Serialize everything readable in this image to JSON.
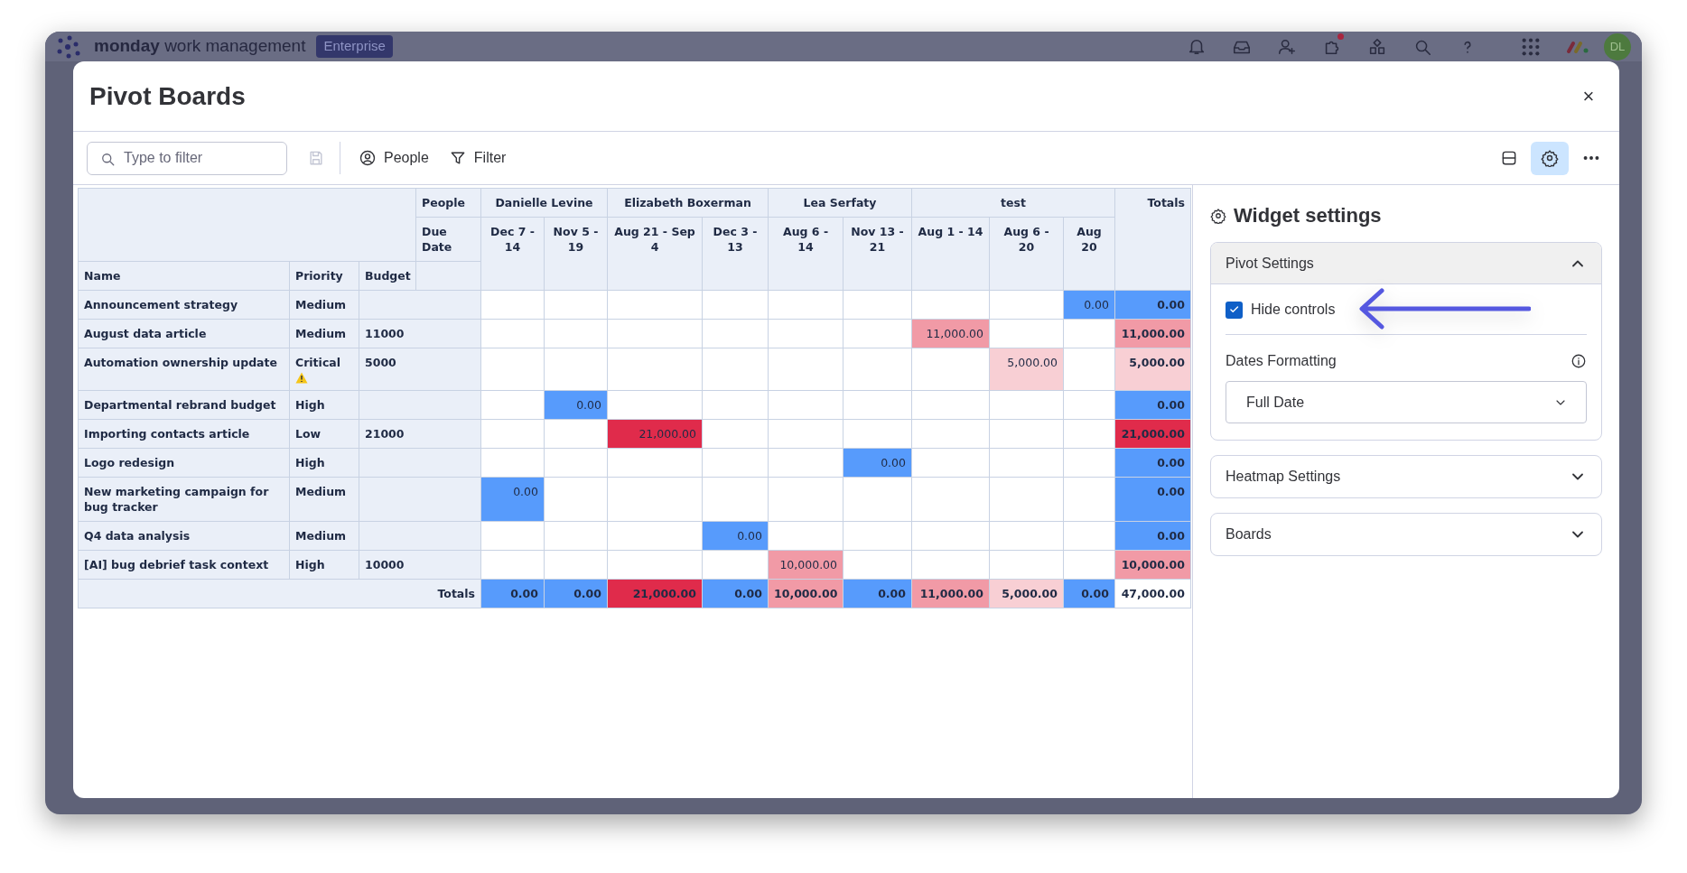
{
  "app_bar": {
    "brand_bold": "monday",
    "brand_rest": "work management",
    "plan_badge": "Enterprise",
    "avatar": "DL",
    "notification_dot": true
  },
  "modal": {
    "title": "Pivot Boards",
    "close": "×"
  },
  "toolbar": {
    "search": {
      "placeholder": "Type to filter"
    },
    "save_disabled": true,
    "people_button": "People",
    "filter_button": "Filter",
    "settings_selected": true
  },
  "pivot": {
    "people_label": "People",
    "due_date_label": "Due Date",
    "row_headers": [
      "Name",
      "Priority",
      "Budget"
    ],
    "totals_label": "Totals",
    "groups": [
      {
        "name": "Danielle Levine",
        "dates": [
          "Dec 7 - 14",
          "Nov 5 - 19"
        ]
      },
      {
        "name": "Elizabeth Boxerman",
        "dates": [
          "Aug 21 - Sep 4",
          "Dec 3 - 13"
        ]
      },
      {
        "name": "Lea Serfaty",
        "dates": [
          "Aug 6 - 14",
          "Nov 13 - 21"
        ]
      },
      {
        "name": "test",
        "dates": [
          "Aug 1 - 14",
          "Aug 6 - 20",
          "Aug 20"
        ]
      }
    ],
    "rows": [
      {
        "name": "Announcement strategy",
        "priority": "Medium",
        "warning": false,
        "budget": "",
        "cells": [
          null,
          null,
          null,
          null,
          null,
          null,
          null,
          null,
          {
            "value": "0.00",
            "color": "#579bfc"
          }
        ],
        "total": {
          "value": "0.00",
          "color": "#579bfc"
        }
      },
      {
        "name": "August data article",
        "priority": "Medium",
        "warning": false,
        "budget": "11000",
        "cells": [
          null,
          null,
          null,
          null,
          null,
          null,
          {
            "value": "11,000.00",
            "color": "#f19aa6"
          },
          null,
          null
        ],
        "total": {
          "value": "11,000.00",
          "color": "#f19aa6"
        }
      },
      {
        "name": "Automation ownership update",
        "priority": "Critical",
        "warning": true,
        "budget": "5000",
        "cells": [
          null,
          null,
          null,
          null,
          null,
          null,
          null,
          {
            "value": "5,000.00",
            "color": "#f8cfd4"
          },
          null
        ],
        "total": {
          "value": "5,000.00",
          "color": "#f8cfd4"
        }
      },
      {
        "name": "Departmental rebrand budget",
        "priority": "High",
        "warning": false,
        "budget": "",
        "cells": [
          null,
          {
            "value": "0.00",
            "color": "#579bfc"
          },
          null,
          null,
          null,
          null,
          null,
          null,
          null
        ],
        "total": {
          "value": "0.00",
          "color": "#579bfc"
        }
      },
      {
        "name": "Importing contacts article",
        "priority": "Low",
        "warning": false,
        "budget": "21000",
        "cells": [
          null,
          null,
          {
            "value": "21,000.00",
            "color": "#e02b4b"
          },
          null,
          null,
          null,
          null,
          null,
          null
        ],
        "total": {
          "value": "21,000.00",
          "color": "#e02b4b"
        }
      },
      {
        "name": "Logo redesign",
        "priority": "High",
        "warning": false,
        "budget": "",
        "cells": [
          null,
          null,
          null,
          null,
          null,
          {
            "value": "0.00",
            "color": "#579bfc"
          },
          null,
          null,
          null
        ],
        "total": {
          "value": "0.00",
          "color": "#579bfc"
        }
      },
      {
        "name": "New marketing campaign for bug tracker",
        "priority": "Medium",
        "warning": false,
        "budget": "",
        "cells": [
          {
            "value": "0.00",
            "color": "#579bfc"
          },
          null,
          null,
          null,
          null,
          null,
          null,
          null,
          null
        ],
        "total": {
          "value": "0.00",
          "color": "#579bfc"
        }
      },
      {
        "name": "Q4 data analysis",
        "priority": "Medium",
        "warning": false,
        "budget": "",
        "cells": [
          null,
          null,
          null,
          {
            "value": "0.00",
            "color": "#579bfc"
          },
          null,
          null,
          null,
          null,
          null
        ],
        "total": {
          "value": "0.00",
          "color": "#579bfc"
        }
      },
      {
        "name": "[AI] bug debrief task context",
        "priority": "High",
        "warning": false,
        "budget": "10000",
        "cells": [
          null,
          null,
          null,
          null,
          {
            "value": "10,000.00",
            "color": "#f19aa6"
          },
          null,
          null,
          null,
          null
        ],
        "total": {
          "value": "10,000.00",
          "color": "#f19aa6"
        }
      }
    ],
    "totals": [
      {
        "value": "0.00",
        "color": "#579bfc"
      },
      {
        "value": "0.00",
        "color": "#579bfc"
      },
      {
        "value": "21,000.00",
        "color": "#e02b4b"
      },
      {
        "value": "0.00",
        "color": "#579bfc"
      },
      {
        "value": "10,000.00",
        "color": "#f19aa6"
      },
      {
        "value": "0.00",
        "color": "#579bfc"
      },
      {
        "value": "11,000.00",
        "color": "#f19aa6"
      },
      {
        "value": "5,000.00",
        "color": "#f8cfd4"
      },
      {
        "value": "0.00",
        "color": "#579bfc"
      }
    ],
    "totals_row_label": "Totals",
    "grand_total": {
      "value": "47,000.00"
    }
  },
  "settings": {
    "title": "Widget settings",
    "sections": [
      {
        "title": "Pivot Settings",
        "expanded": true,
        "hide_controls": {
          "label": "Hide controls",
          "checked": true
        },
        "dates_formatting": {
          "label": "Dates Formatting",
          "value": "Full Date"
        }
      },
      {
        "title": "Heatmap Settings",
        "expanded": false
      },
      {
        "title": "Boards",
        "expanded": false
      }
    ]
  }
}
